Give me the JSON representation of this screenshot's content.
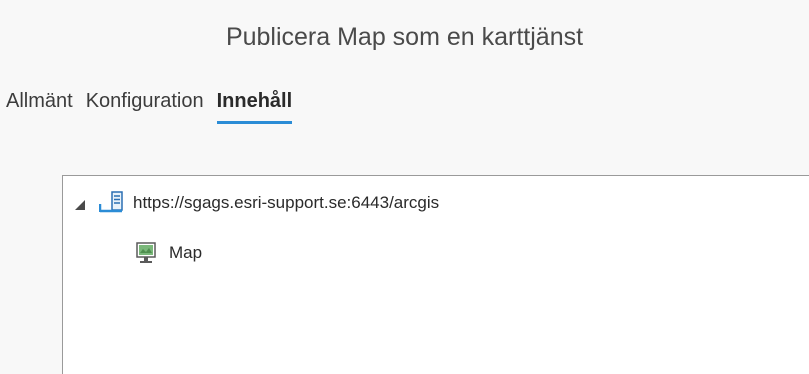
{
  "dialog": {
    "title": "Publicera Map som en karttjänst"
  },
  "tabs": [
    {
      "label": "Allmänt",
      "active": false
    },
    {
      "label": "Konfiguration",
      "active": false
    },
    {
      "label": "Innehåll",
      "active": true
    }
  ],
  "tree": {
    "server": {
      "label": "https://sgags.esri-support.se:6443/arcgis",
      "icon": "server-connection-icon",
      "expanded": true
    },
    "children": [
      {
        "label": "Map",
        "icon": "map-icon"
      }
    ]
  },
  "colors": {
    "accent": "#2b8cd6",
    "border": "#9a9a9a"
  }
}
